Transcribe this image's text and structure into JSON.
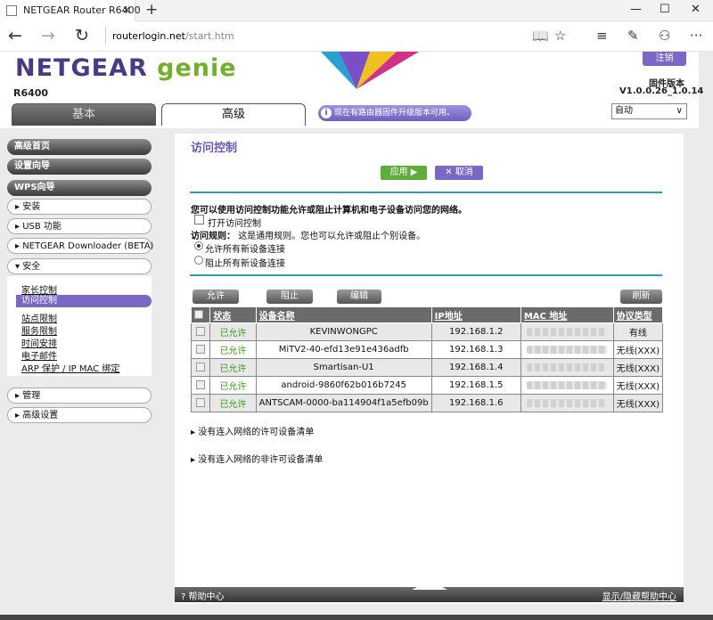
{
  "browser": {
    "tab_title": "NETGEAR Router R6400",
    "tab_close": "×",
    "new_tab": "+",
    "url_host": "routerlogin.net",
    "url_path": "/start.htm"
  },
  "header": {
    "brand": "NETGEAR",
    "product": "genie",
    "model": "R6400",
    "logout": "注销",
    "firmware_label": "固件版本",
    "firmware_version": "V1.0.0.26_1.0.14",
    "tab_basic": "基本",
    "tab_advanced": "高级",
    "update_notice": "现在有路由器固件升级版本可用。",
    "language": "自动"
  },
  "sidebar": {
    "advanced_home": "高级首页",
    "setup_wizard": "设置向导",
    "wps_wizard": "WPS向导",
    "setup": "安装",
    "usb": "USB 功能",
    "downloader": "NETGEAR Downloader (BETA)",
    "security": "安全",
    "security_items": [
      "家长控制",
      "访问控制",
      "站点限制",
      "服务限制",
      "时间安排",
      "电子邮件",
      "ARP 保护 / IP MAC 绑定"
    ],
    "admin": "管理",
    "advanced_setup": "高级设置"
  },
  "main": {
    "title": "访问控制",
    "apply": "应用 ▶",
    "cancel": "✕ 取消",
    "intro": "您可以使用访问控制功能允许或阻止计算机和电子设备访问您的网络。",
    "enable_label": "打开访问控制",
    "rule_label": "访问规则：",
    "rule_text": "这是通用规则。您也可以允许或阻止个别设备。",
    "allow_new": "允许所有新设备连接",
    "block_new": "阻止所有新设备连接",
    "btn_allow": "允许",
    "btn_block": "阻止",
    "btn_edit": "编辑",
    "btn_refresh": "刷新",
    "columns": [
      "状态",
      "设备名称",
      "IP地址",
      "MAC 地址",
      "协议类型"
    ],
    "rows": [
      {
        "status": "已允许",
        "name": "KEVINWONGPC",
        "ip": "192.168.1.2",
        "conn": "有线"
      },
      {
        "status": "已允许",
        "name": "MiTV2-40-efd13e91e436adfb",
        "ip": "192.168.1.3",
        "conn": "无线(XXX)"
      },
      {
        "status": "已允许",
        "name": "Smartisan-U1",
        "ip": "192.168.1.4",
        "conn": "无线(XXX)"
      },
      {
        "status": "已允许",
        "name": "android-9860f62b016b7245",
        "ip": "192.168.1.5",
        "conn": "无线(XXX)"
      },
      {
        "status": "已允许",
        "name": "ANTSCAM-0000-ba114904f1a5efb09b",
        "ip": "192.168.1.6",
        "conn": "无线(XXX)"
      }
    ],
    "allowed_list": "没有连入网络的许可设备清单",
    "blocked_list": "没有连入网络的非许可设备清单"
  },
  "footer": {
    "help": "帮助中心",
    "toggle": "显示/隐藏帮助中心"
  },
  "colors": {
    "purple": "#7b68c4",
    "green": "#5fae3b",
    "teal": "#2aa0b7"
  }
}
